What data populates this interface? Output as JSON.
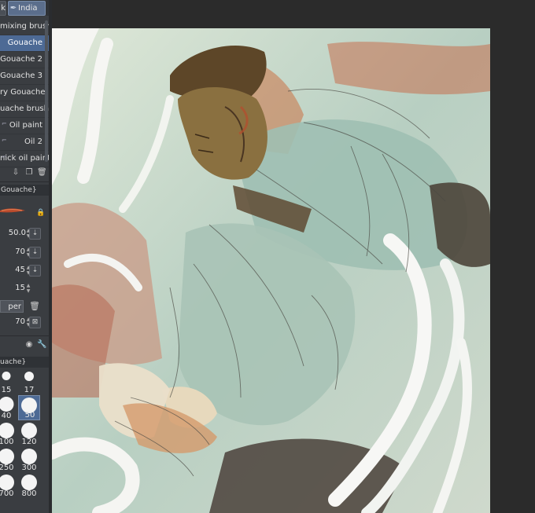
{
  "tabs": [
    {
      "label": "k"
    },
    {
      "label": "India"
    }
  ],
  "brushes": [
    {
      "label": "mixing brush"
    },
    {
      "label": "Gouache",
      "selected": true
    },
    {
      "label": "Gouache 2"
    },
    {
      "label": "Gouache 3"
    },
    {
      "label": "ry Gouache"
    },
    {
      "label": "uache brush"
    },
    {
      "label": "Oil paint"
    },
    {
      "label": "Oil 2"
    },
    {
      "label": "nick oil paint"
    }
  ],
  "sub_tool_detail": {
    "header": "Gouache}",
    "params": [
      "50.0",
      "70",
      "45",
      "15"
    ],
    "paper_label": "per",
    "paper_value": "70"
  },
  "size_header": "uache}",
  "sizes": [
    "15",
    "17",
    "40",
    "50",
    "100",
    "120",
    "250",
    "300",
    "700",
    "800"
  ],
  "selected_size": "50",
  "colors": {
    "accent": "#4d6a95",
    "panel": "#3a3d41",
    "app_bg": "#2b2b2b"
  }
}
